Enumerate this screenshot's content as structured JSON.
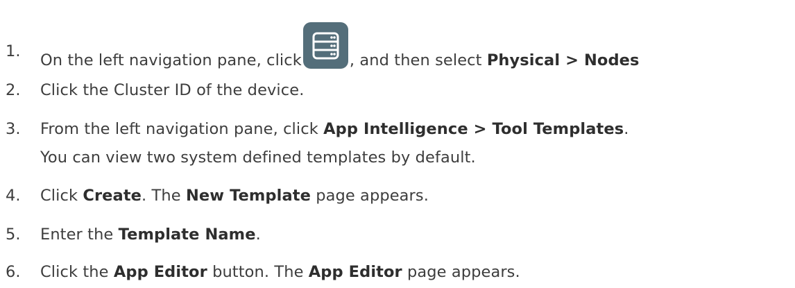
{
  "steps": [
    {
      "number": "1.",
      "before": "On the left navigation pane, click",
      "icon": "server-icon",
      "middle": ", and then select ",
      "bold": "Physical > Nodes"
    },
    {
      "number": "2.",
      "text": "Click the Cluster ID of the device."
    },
    {
      "number": "3.",
      "before": "From the left navigation pane, click ",
      "bold": "App Intelligence > Tool Templates",
      "after": ".",
      "continuation": "You can view two system defined templates by default."
    },
    {
      "number": "4.",
      "before": "Click ",
      "bold": "Create",
      "middle": ". The ",
      "bold2": "New Template",
      "after": " page appears."
    },
    {
      "number": "5.",
      "before": "Enter the ",
      "bold": "Template Name",
      "after": "."
    },
    {
      "number": "6.",
      "before": "Click the ",
      "bold": "App Editor",
      "middle": " button. The ",
      "bold2": "App Editor",
      "after": " page appears."
    }
  ],
  "colors": {
    "text": "#3d3d3d",
    "icon_bg": "#546e7a",
    "icon_fg": "#ffffff"
  }
}
